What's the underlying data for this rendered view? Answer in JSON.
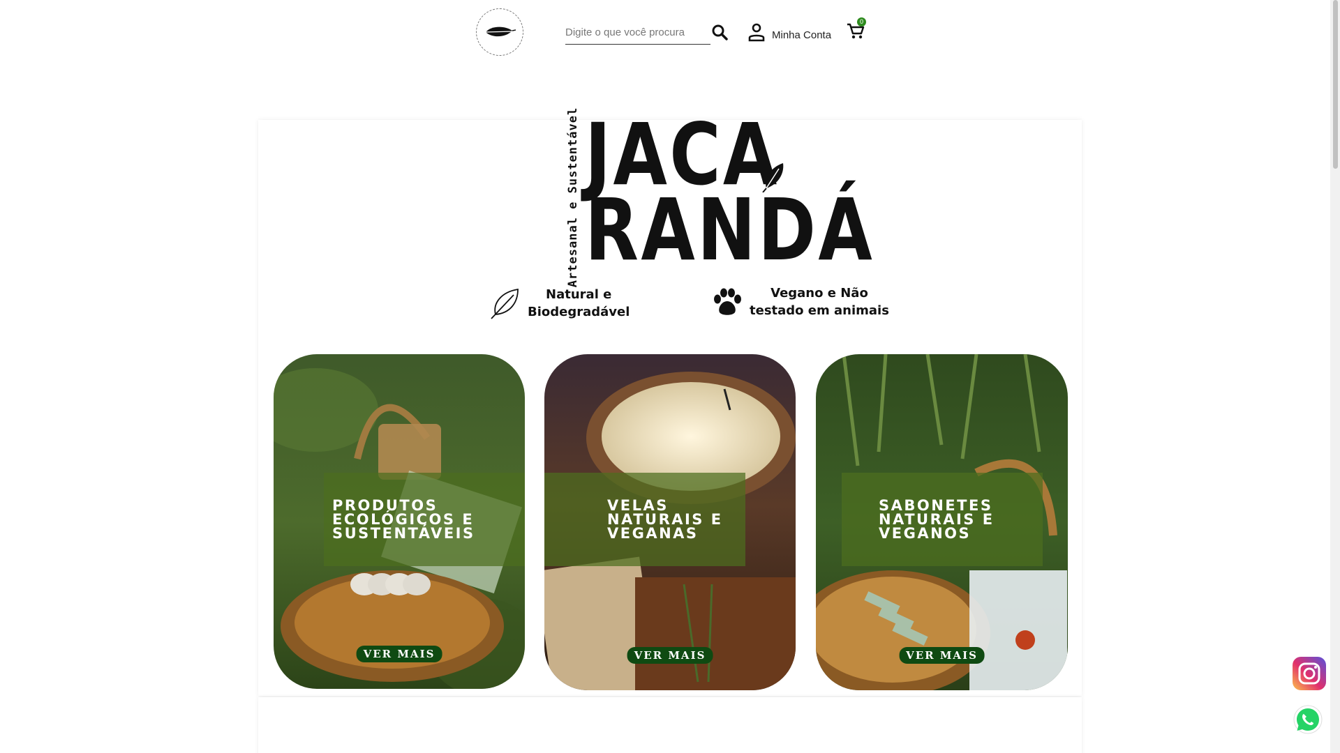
{
  "header": {
    "logo_icon": "leaf-circle-logo",
    "search": {
      "placeholder": "Digite o que você procura",
      "value": "",
      "icon": "search-icon"
    },
    "account": {
      "label": "Minha Conta",
      "icon": "user-icon"
    },
    "cart": {
      "count": "0",
      "icon": "cart-icon"
    }
  },
  "brand": {
    "tagline": "Artesanal e Sustentável",
    "name_line1": "JACA",
    "name_line2": "RANDÁ",
    "logo_text_note": "logo lettering"
  },
  "features": [
    {
      "icon": "leaf-outline-icon",
      "line1": "Natural e",
      "line2": "Biodegradável"
    },
    {
      "icon": "paw-icon",
      "line1": "Vegano e Não",
      "line2": "testado em animais"
    }
  ],
  "categories": [
    {
      "title": "Produtos ecológicos e sustentáveis",
      "button": "VER MAIS",
      "image": "basket-soap-on-grass"
    },
    {
      "title": "Velas naturais e veganas",
      "button": "VER MAIS",
      "image": "candle-in-coconut"
    },
    {
      "title": "Sabonetes naturais e veganos",
      "button": "VER MAIS",
      "image": "soap-bars-on-wood"
    }
  ],
  "floating": [
    {
      "icon": "instagram-icon"
    },
    {
      "icon": "whatsapp-icon"
    }
  ],
  "colors": {
    "accent_green": "#2e8b1e",
    "button_green": "#0f4a12",
    "overlay_green": "#4c6e1e"
  }
}
